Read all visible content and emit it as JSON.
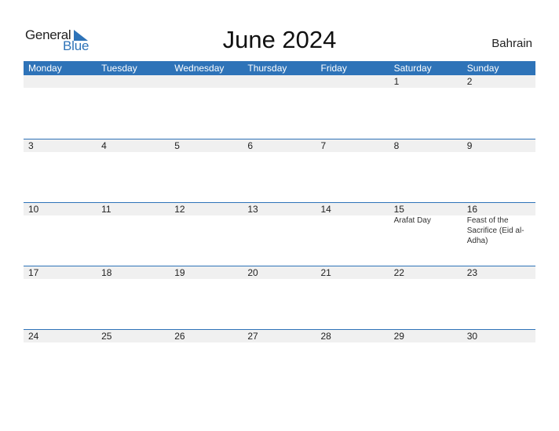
{
  "logo": {
    "text_top": "General",
    "text_bottom": "Blue",
    "icon": "triangle-flag-icon",
    "brand_color": "#2e73b8"
  },
  "header": {
    "title": "June 2024",
    "country": "Bahrain"
  },
  "weekdays": [
    "Monday",
    "Tuesday",
    "Wednesday",
    "Thursday",
    "Friday",
    "Saturday",
    "Sunday"
  ],
  "weeks": [
    {
      "days": [
        {
          "day": ""
        },
        {
          "day": ""
        },
        {
          "day": ""
        },
        {
          "day": ""
        },
        {
          "day": ""
        },
        {
          "day": "1"
        },
        {
          "day": "2"
        }
      ]
    },
    {
      "days": [
        {
          "day": "3"
        },
        {
          "day": "4"
        },
        {
          "day": "5"
        },
        {
          "day": "6"
        },
        {
          "day": "7"
        },
        {
          "day": "8"
        },
        {
          "day": "9"
        }
      ]
    },
    {
      "days": [
        {
          "day": "10"
        },
        {
          "day": "11"
        },
        {
          "day": "12"
        },
        {
          "day": "13"
        },
        {
          "day": "14"
        },
        {
          "day": "15",
          "event": "Arafat Day"
        },
        {
          "day": "16",
          "event": "Feast of the Sacrifice (Eid al-Adha)"
        }
      ]
    },
    {
      "days": [
        {
          "day": "17"
        },
        {
          "day": "18"
        },
        {
          "day": "19"
        },
        {
          "day": "20"
        },
        {
          "day": "21"
        },
        {
          "day": "22"
        },
        {
          "day": "23"
        }
      ]
    },
    {
      "days": [
        {
          "day": "24"
        },
        {
          "day": "25"
        },
        {
          "day": "26"
        },
        {
          "day": "27"
        },
        {
          "day": "28"
        },
        {
          "day": "29"
        },
        {
          "day": "30"
        }
      ]
    }
  ],
  "colors": {
    "header_bg": "#2e73b8",
    "date_band": "#f0f0f0"
  }
}
